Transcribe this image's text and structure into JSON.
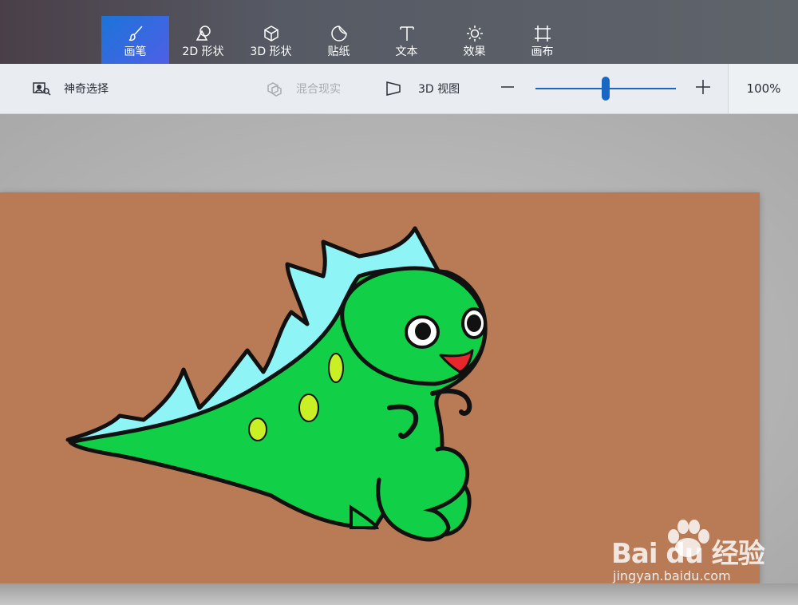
{
  "toolbar": {
    "tools": [
      {
        "label": "画笔",
        "icon": "brush-icon",
        "active": true
      },
      {
        "label": "2D 形状",
        "icon": "shapes-2d-icon",
        "active": false
      },
      {
        "label": "3D 形状",
        "icon": "cube-3d-icon",
        "active": false
      },
      {
        "label": "贴纸",
        "icon": "sticker-icon",
        "active": false
      },
      {
        "label": "文本",
        "icon": "text-icon",
        "active": false
      },
      {
        "label": "效果",
        "icon": "sun-effects-icon",
        "active": false
      },
      {
        "label": "画布",
        "icon": "canvas-crop-icon",
        "active": false
      }
    ],
    "active_color": "#2b6fde"
  },
  "subbar": {
    "magic_select": {
      "label": "神奇选择",
      "icon": "magic-select-icon"
    },
    "mixed_reality": {
      "label": "混合现实",
      "icon": "mixed-reality-icon",
      "disabled": true
    },
    "view_3d": {
      "label": "3D 视图",
      "icon": "view-3d-icon"
    },
    "zoom": {
      "value": "100%",
      "level": 0.5,
      "minus_icon": "minus-icon",
      "plus_icon": "plus-icon"
    }
  },
  "canvas": {
    "background_color": "#b87b56",
    "drawing": "dinosaur-illustration"
  },
  "watermark": {
    "brand": "Bai du 经验",
    "url": "jingyan.baidu.com"
  }
}
